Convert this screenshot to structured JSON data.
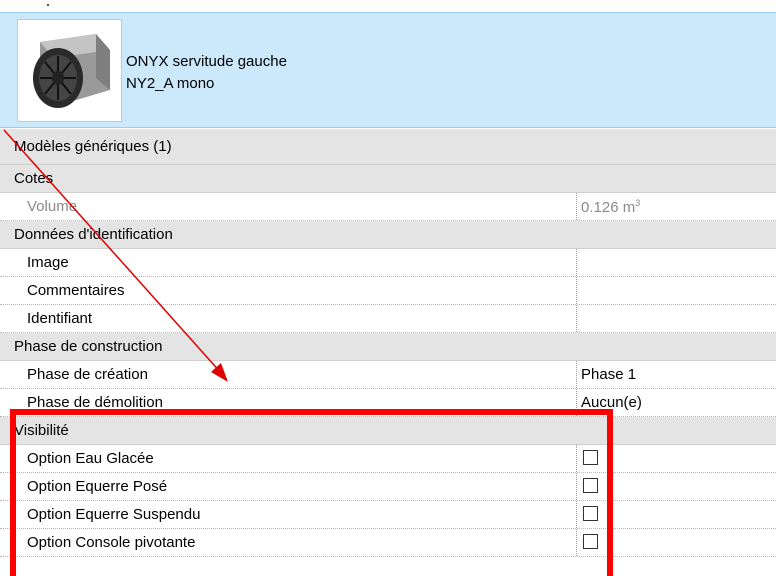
{
  "type_selector": {
    "name_line1": "ONYX servitude gauche",
    "name_line2": "NY2_A mono",
    "thumbnail_icon": "outdoor-unit-fan-icon"
  },
  "category": {
    "label": "Modèles génériques (1)"
  },
  "groups": {
    "cotes": {
      "label": "Cotes",
      "rows": [
        {
          "label": "Volume",
          "value": "0.126 m",
          "unit_superscript": "3"
        }
      ]
    },
    "identification": {
      "label": "Données d'identification",
      "rows": [
        {
          "label": "Image",
          "value": ""
        },
        {
          "label": "Commentaires",
          "value": ""
        },
        {
          "label": "Identifiant",
          "value": ""
        }
      ]
    },
    "phase": {
      "label": "Phase de construction",
      "rows": [
        {
          "label": "Phase de création",
          "value": "Phase 1"
        },
        {
          "label": "Phase de démolition",
          "value": "Aucun(e)"
        }
      ]
    },
    "visibilite": {
      "label": "Visibilité",
      "rows": [
        {
          "label": "Option Eau Glacée",
          "checked": false
        },
        {
          "label": "Option Equerre Posé",
          "checked": false
        },
        {
          "label": "Option Equerre Suspendu",
          "checked": false
        },
        {
          "label": "Option Console pivotante",
          "checked": false
        }
      ]
    }
  },
  "annotation": {
    "highlight_color": "#ff0000"
  }
}
